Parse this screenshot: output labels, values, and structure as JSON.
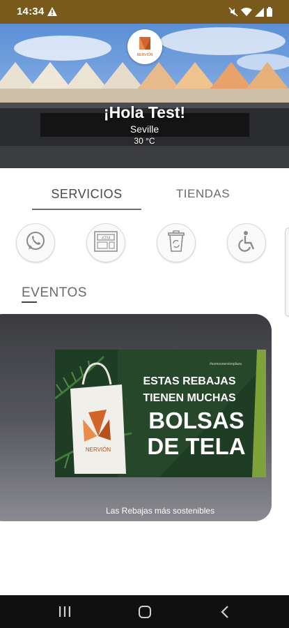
{
  "status_bar": {
    "time": "14:34",
    "icons": [
      "warning-icon",
      "mute-icon",
      "wifi-icon",
      "signal-icon",
      "battery-icon"
    ]
  },
  "hero": {
    "logo_text": "NERVIÓN",
    "greeting": "¡Hola Test!",
    "city": "Seville",
    "temperature": "30 °C"
  },
  "tabs": [
    {
      "label": "SERVICIOS",
      "active": true
    },
    {
      "label": "TIENDAS",
      "active": false
    }
  ],
  "services": [
    {
      "icon": "whatsapp-icon"
    },
    {
      "icon": "atm-icon",
      "label": "ATM"
    },
    {
      "icon": "recycle-bin-icon"
    },
    {
      "icon": "wheelchair-icon"
    }
  ],
  "eventos": {
    "title": "EVENTOS",
    "card": {
      "banner_hashtag": "#somosnervionplaza",
      "banner_line1": "ESTAS REBAJAS",
      "banner_line2": "TIENEN MUCHAS",
      "banner_line3": "BOLSAS",
      "banner_line4": "DE TELA",
      "bag_logo_text": "NERVIÓN",
      "caption": "Las Rebajas más sostenibles"
    }
  },
  "colors": {
    "status_bar": "#7a5a1c",
    "brand_orange": "#d4642a",
    "banner_green": "#1f3d24"
  }
}
